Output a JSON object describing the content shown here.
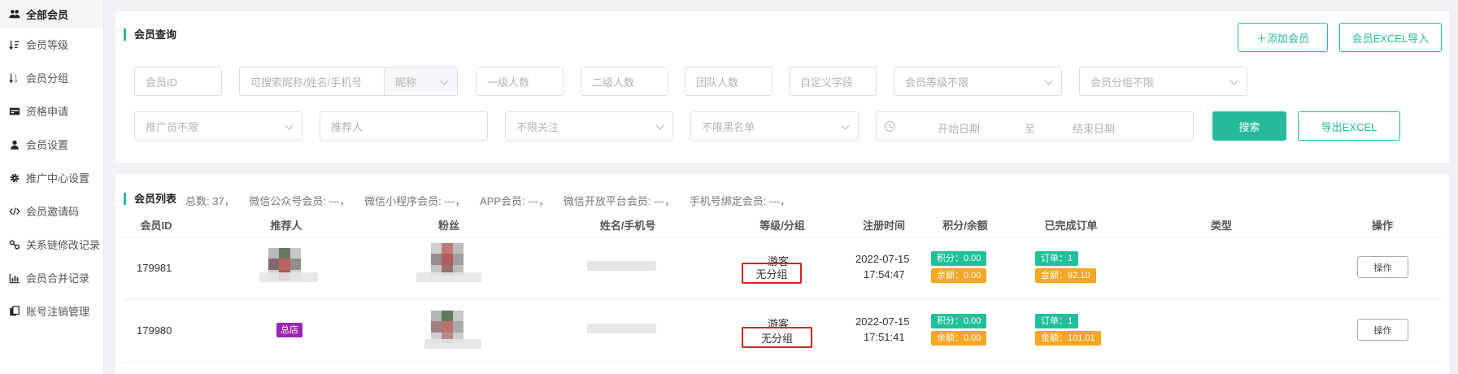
{
  "sidebar": {
    "items": [
      {
        "label": "全部会员",
        "icon": "users-icon"
      },
      {
        "label": "会员等级",
        "icon": "sort-level-icon"
      },
      {
        "label": "会员分组",
        "icon": "sort-group-icon"
      },
      {
        "label": "资格申请",
        "icon": "id-card-icon"
      },
      {
        "label": "会员设置",
        "icon": "user-icon"
      },
      {
        "label": "推广中心设置",
        "icon": "gear-icon"
      },
      {
        "label": "会员邀请码",
        "icon": "code-icon"
      },
      {
        "label": "关系链修改记录",
        "icon": "link-icon"
      },
      {
        "label": "会员合并记录",
        "icon": "bar-chart-icon"
      },
      {
        "label": "账号注销管理",
        "icon": "copy-icon"
      }
    ]
  },
  "query": {
    "title": "会员查询",
    "add_member": "＋添加会员",
    "import_excel": "会员EXCEL导入",
    "member_id": "会员ID",
    "keyword": "可搜索昵称/姓名/手机号",
    "keyword_type": "昵称",
    "level1": "一级人数",
    "level2": "二级人数",
    "team": "团队人数",
    "custom": "自定义字段",
    "member_level": "会员等级不限",
    "member_group": "会员分组不限",
    "promoter": "推广员不限",
    "referrer": "推荐人",
    "follow": "不限关注",
    "blacklist": "不限黑名单",
    "start_date": "开始日期",
    "to": "至",
    "end_date": "结束日期",
    "search": "搜索",
    "export": "导出EXCEL"
  },
  "list": {
    "title": "会员列表",
    "summary": [
      "总数:  37，",
      "微信公众号会员:  ---，",
      "微信小程序会员:  ---，",
      "APP会员:  ---，",
      "微信开放平台会员:  ---，",
      "手机号绑定会员:  ---，"
    ],
    "columns": {
      "id": "会员ID",
      "referrer": "推荐人",
      "fans": "粉丝",
      "name_phone": "姓名/手机号",
      "level_group": "等级/分组",
      "reg_time": "注册时间",
      "points_balance": "积分/余额",
      "orders": "已完成订单",
      "type": "类型",
      "action": "操作"
    },
    "rows": [
      {
        "id": "179981",
        "referrer_badge": "",
        "level": "游客",
        "group": "无分组",
        "date": "2022-07-15",
        "time": "17:54:47",
        "points": "积分：0.00",
        "balance": "余额：0.00",
        "orders": "订单：1",
        "amount": "金额：92.10",
        "action": "操作"
      },
      {
        "id": "179980",
        "referrer_badge": "总店",
        "level": "游客",
        "group": "无分组",
        "date": "2022-07-15",
        "time": "17:51:41",
        "points": "积分：0.00",
        "balance": "余额：0.00",
        "orders": "订单：1",
        "amount": "金额：101.01",
        "action": "操作"
      }
    ]
  },
  "colors": {
    "accent": "#26b99a",
    "tag_green": "#1fc19a",
    "tag_orange": "#f5a623",
    "highlight_red": "#e21d1d",
    "badge_purple": "#9b26b6"
  }
}
